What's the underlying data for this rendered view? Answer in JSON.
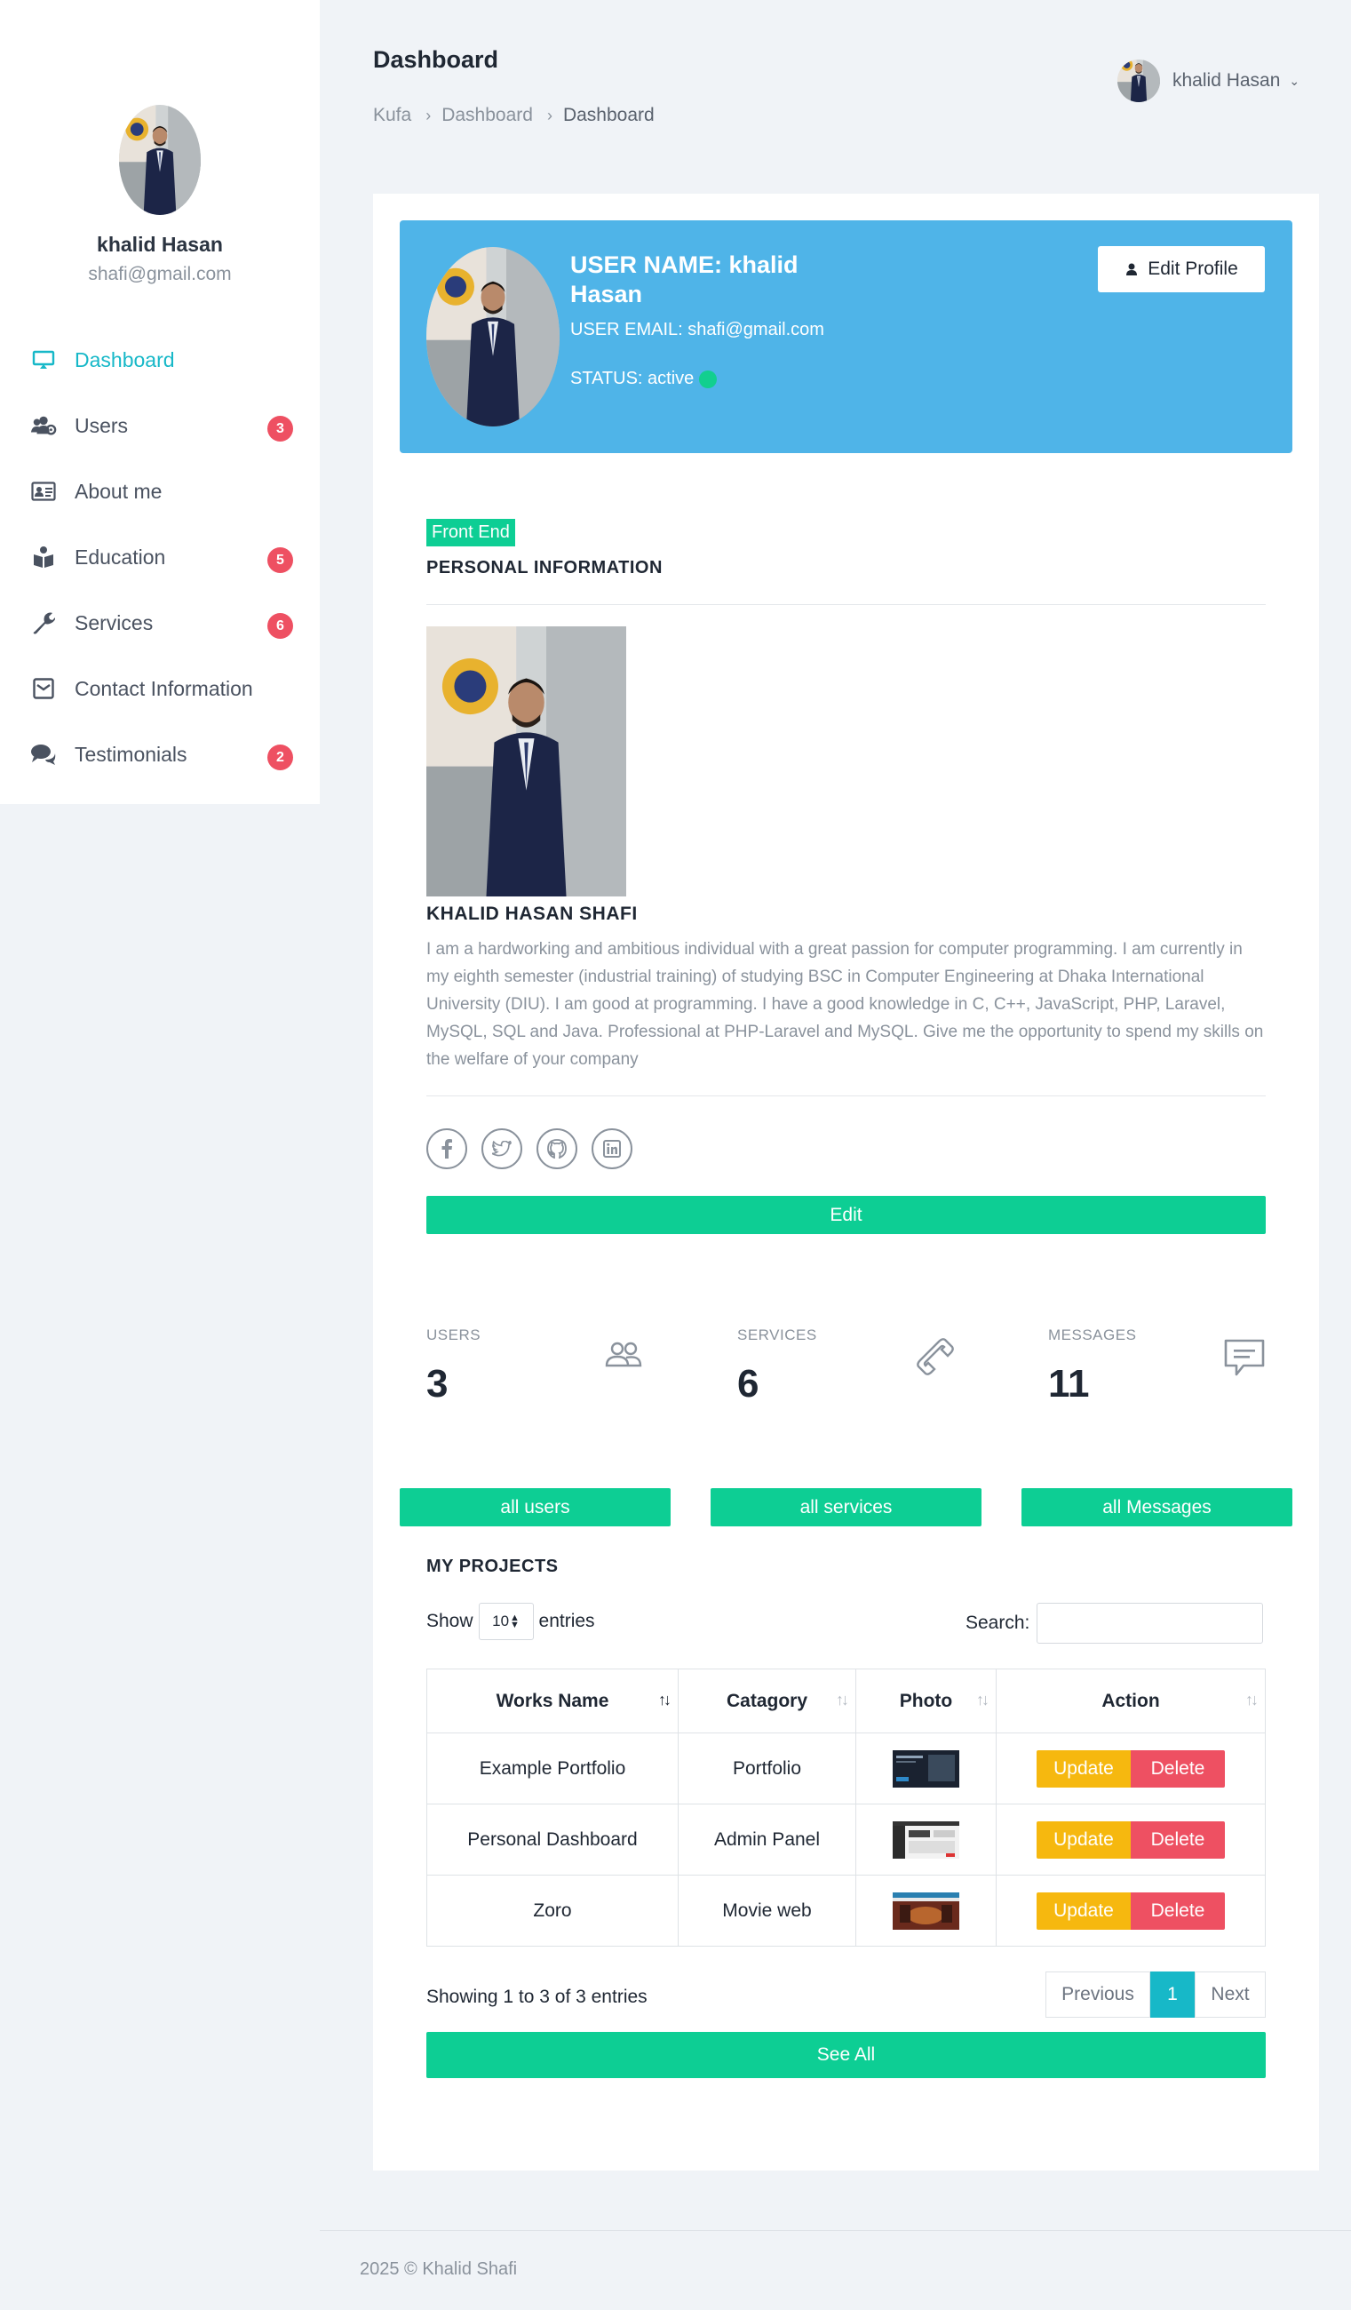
{
  "user": {
    "name": "khalid Hasan",
    "email": "shafi@gmail.com"
  },
  "sidebar": {
    "items": [
      {
        "label": "Dashboard",
        "icon": "monitor-icon",
        "active": true,
        "badge": ""
      },
      {
        "label": "Users",
        "icon": "users-icon",
        "badge": "3"
      },
      {
        "label": "About me",
        "icon": "id-card-icon",
        "badge": ""
      },
      {
        "label": "Education",
        "icon": "book-reader-icon",
        "badge": "5"
      },
      {
        "label": "Services",
        "icon": "wrench-icon",
        "badge": "6"
      },
      {
        "label": "Contact Information",
        "icon": "envelope-icon",
        "badge": ""
      },
      {
        "label": "Testimonials",
        "icon": "comments-icon",
        "badge": "2"
      }
    ]
  },
  "header": {
    "title": "Dashboard",
    "breadcrumb": [
      "Kufa",
      "Dashboard",
      "Dashboard"
    ],
    "user_menu_name": "khalid Hasan"
  },
  "profile": {
    "name_line": "USER NAME: khalid Hasan",
    "email_line": "USER EMAIL: shafi@gmail.com",
    "status_line": "STATUS: active",
    "edit_label": "Edit Profile"
  },
  "personal": {
    "tag": "Front End",
    "heading": "PERSONAL INFORMATION",
    "full_name": "KHALID HASAN SHAFI",
    "bio": "I am a hardworking and ambitious individual with a great passion for computer programming. I am currently in my eighth semester (industrial training) of studying BSC in Computer Engineering at Dhaka International University (DIU). I am good at programming. I have a good knowledge in C, C++, JavaScript, PHP, Laravel, MySQL, SQL and Java. Professional at PHP-Laravel and MySQL. Give me the opportunity to spend my skills on the welfare of your company",
    "socials": [
      "facebook-icon",
      "twitter-icon",
      "github-icon",
      "linkedin-icon"
    ],
    "edit_label": "Edit"
  },
  "stats": [
    {
      "label": "USERS",
      "value": "3",
      "icon": "users-outline-icon",
      "button": "all users"
    },
    {
      "label": "SERVICES",
      "value": "6",
      "icon": "phone-icon",
      "button": "all services"
    },
    {
      "label": "MESSAGES",
      "value": "11",
      "icon": "message-icon",
      "button": "all Messages"
    }
  ],
  "projects": {
    "heading": "MY PROJECTS",
    "show_label": "Show",
    "show_value": "10",
    "entries_label": "entries",
    "search_label": "Search:",
    "columns": [
      "Works Name",
      "Catagory",
      "Photo",
      "Action"
    ],
    "rows": [
      {
        "name": "Example Portfolio",
        "category": "Portfolio"
      },
      {
        "name": "Personal Dashboard",
        "category": "Admin Panel"
      },
      {
        "name": "Zoro",
        "category": "Movie web"
      }
    ],
    "update_label": "Update",
    "delete_label": "Delete",
    "info": "Showing 1 to 3 of 3 entries",
    "prev": "Previous",
    "page": "1",
    "next": "Next",
    "see_all": "See All"
  },
  "footer": "2025 © Khalid Shafi",
  "colors": {
    "accent": "#17b8c8",
    "banner": "#4fb4e8",
    "green": "#0dce94",
    "warning": "#f6b80f",
    "danger": "#ee5062"
  }
}
